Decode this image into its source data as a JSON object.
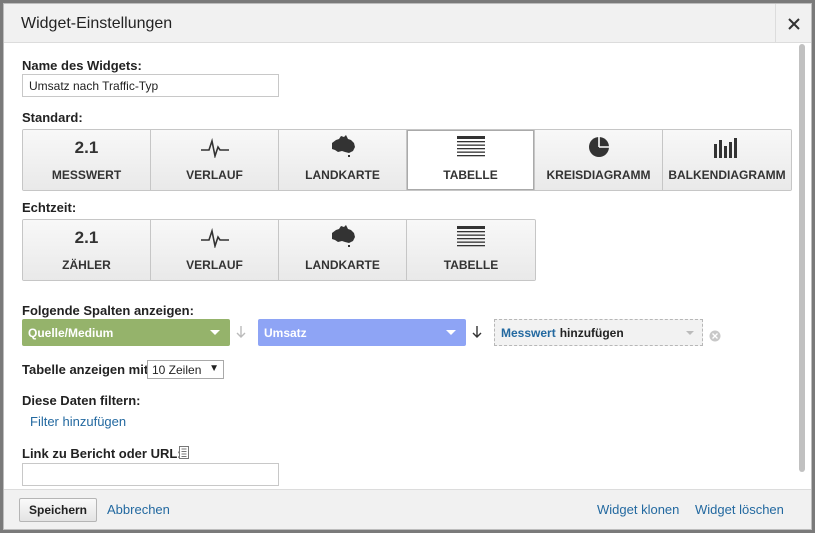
{
  "dialog": {
    "title": "Widget-Einstellungen"
  },
  "name_section": {
    "label": "Name des Widgets:",
    "value": "Umsatz nach Traffic-Typ"
  },
  "standard": {
    "label": "Standard:",
    "buttons": [
      {
        "label": "MESSWERT",
        "icon": "metric-number-icon",
        "icon_text": "2.1"
      },
      {
        "label": "VERLAUF",
        "icon": "timeline-icon"
      },
      {
        "label": "LANDKARTE",
        "icon": "map-icon"
      },
      {
        "label": "TABELLE",
        "icon": "table-icon",
        "selected": true
      },
      {
        "label": "KREISDIAGRAMM",
        "icon": "pie-chart-icon"
      },
      {
        "label": "BALKENDIAGRAMM",
        "icon": "bar-chart-icon"
      }
    ]
  },
  "realtime": {
    "label": "Echtzeit:",
    "buttons": [
      {
        "label": "ZÄHLER",
        "icon": "counter-number-icon",
        "icon_text": "2.1"
      },
      {
        "label": "VERLAUF",
        "icon": "timeline-icon"
      },
      {
        "label": "LANDKARTE",
        "icon": "map-icon"
      },
      {
        "label": "TABELLE",
        "icon": "table-icon"
      }
    ]
  },
  "columns": {
    "label": "Folgende Spalten anzeigen:",
    "dimension": {
      "value": "Quelle/Medium",
      "color": "#95b36b"
    },
    "metric": {
      "value": "Umsatz",
      "color": "#8ea4f5"
    },
    "add_metric": {
      "link_text": "Messwert",
      "rest_text": "hinzufügen"
    }
  },
  "table_rows": {
    "label": "Tabelle anzeigen mit",
    "value": "10 Zeilen"
  },
  "filter": {
    "label": "Diese Daten filtern:",
    "add_link": "Filter hinzufügen"
  },
  "link_section": {
    "label": "Link zu Bericht oder URL:",
    "value": ""
  },
  "footer": {
    "save": "Speichern",
    "cancel": "Abbrechen",
    "clone": "Widget klonen",
    "delete": "Widget löschen"
  },
  "colors": {
    "link": "#2369a0",
    "footer_bg": "#f1f1f1"
  }
}
